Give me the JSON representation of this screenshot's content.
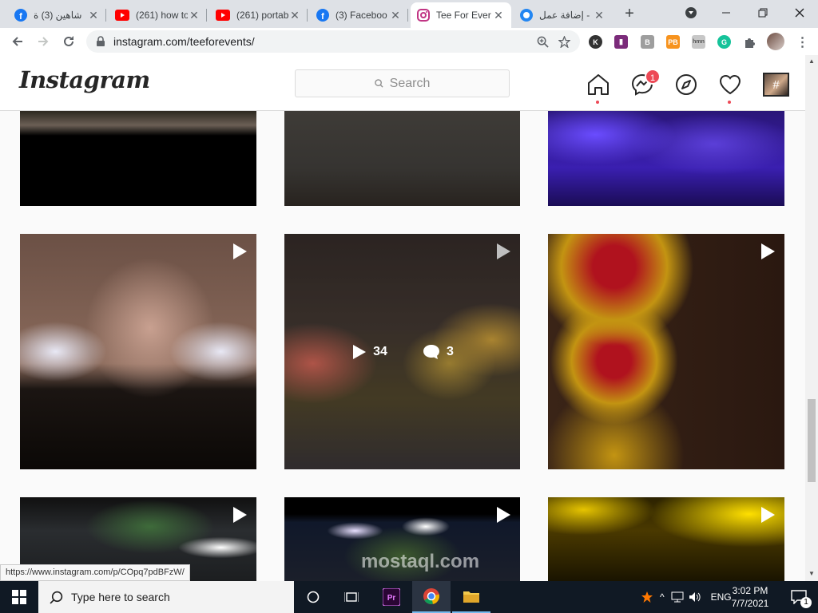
{
  "browser": {
    "tabs": [
      {
        "title": "شاهين (3) ‌ة",
        "icon": "facebook-icon",
        "color": "#1877f2"
      },
      {
        "title": "(261) how to",
        "icon": "youtube-icon",
        "color": "#ff0000"
      },
      {
        "title": "(261) portab",
        "icon": "youtube-icon",
        "color": "#ff0000"
      },
      {
        "title": "(3) Faceboo",
        "icon": "facebook-icon",
        "color": "#1877f2"
      },
      {
        "title": "Tee For Ever",
        "icon": "instagram-icon",
        "color": "#c13584",
        "active": true
      },
      {
        "title": "إضافة عمل -",
        "icon": "mostaql-icon",
        "color": "#2386f2"
      }
    ],
    "url": "instagram.com/teeforevents/"
  },
  "instagram": {
    "logo": "Instagram",
    "search_placeholder": "Search",
    "messenger_badge": "1",
    "avatar_glyph": "#"
  },
  "posts": [
    {
      "bg": "linear-gradient(180deg,#2c2820 0%,#6b5f55 15%,#000 26%,#000 100%)"
    },
    {
      "bg": "linear-gradient(180deg,#3e3b37 0%,#363431 60%,#28231f 100%)"
    },
    {
      "bg": "radial-gradient(ellipse at 20% 25%,#6a4cff 0%,transparent 30%),radial-gradient(ellipse at 70% 35%,#5b3fd8 0%,transparent 35%),linear-gradient(180deg,#2a1678 0%,#3a1fb0 60%,#1a0c55 100%)",
      "video": false
    },
    {
      "bg": "radial-gradient(ellipse at 15% 50%,#e8e8f5 0%,transparent 18%),radial-gradient(ellipse at 85% 50%,#e8e8f5 0%,transparent 18%),radial-gradient(ellipse at 55% 40%,#c8a090 0%,transparent 35%),linear-gradient(180deg,#6b5045 0%,#8a6a5b 55%,#1b1512 66%,#0b0806 100%)",
      "video": true
    },
    {
      "bg": "radial-gradient(ellipse at 12% 55%,#e87060 0%,transparent 22%),radial-gradient(ellipse at 88% 45%,#e2b040 0%,transparent 20%),radial-gradient(ellipse at 70% 55%,#c9a440 0%,transparent 20%),linear-gradient(180deg,#3a302d 0%,#4a3e37 40%,#5a4e30 70%,#3f3a3d 100%)",
      "video": true,
      "views": "34",
      "comments": "3"
    },
    {
      "bg": "radial-gradient(circle at 28% 14%,#b0121e 0%,#b0121e 8%,#c39412 20%,transparent 30%),radial-gradient(circle at 28% 54%,#b0121e 0%,#b0121e 8%,#c39412 20%,transparent 30%),radial-gradient(circle at 28% 94%,#c39412 0%,transparent 25%),linear-gradient(90deg,#3a2417 0%,#2a1810 100%)",
      "video": true
    },
    {
      "bg": "radial-gradient(ellipse at 85% 60%,#ffffff 0%,transparent 15%),radial-gradient(ellipse at 55% 35%,#3e6b3a 0%,transparent 35%),linear-gradient(180deg,#101010 0%,#2a2d30 40%,#1c1e20 100%)",
      "video": true
    },
    {
      "bg": "radial-gradient(ellipse at 30% 40%,#e8e0ff 0%,transparent 12%),radial-gradient(ellipse at 60% 35%,#fff 0%,transparent 12%),radial-gradient(ellipse at 50% 70%,#3d5a2e 0%,transparent 35%),linear-gradient(180deg,#000 0%,#000 20%,#10182a 30%,#1b1f2a 100%)",
      "video": true
    },
    {
      "bg": "radial-gradient(ellipse at 15% 15%,#e6c400 0%,transparent 25%),radial-gradient(ellipse at 85% 20%,#ffe000 0%,transparent 35%),linear-gradient(180deg,#2c2200 0%,#4a3900 40%,#1a1400 100%)",
      "video": true
    }
  ],
  "status_url": "https://www.instagram.com/p/COpq7pdBFzW/",
  "taskbar": {
    "search_placeholder": "Type here to search",
    "language": "ENG",
    "time": "3:02 PM",
    "date": "7/7/2021",
    "notifications": "1",
    "watermark": "mostaql.com"
  }
}
